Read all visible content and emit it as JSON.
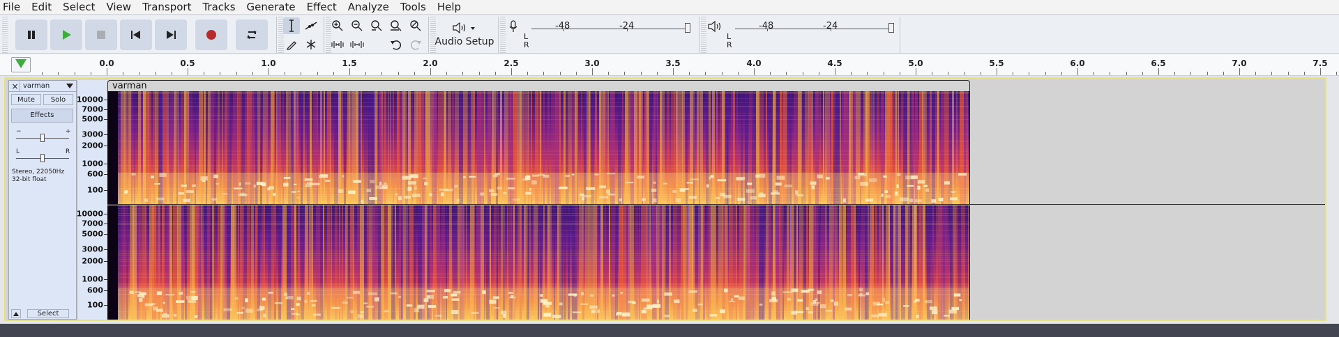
{
  "menu": [
    "File",
    "Edit",
    "Select",
    "View",
    "Transport",
    "Tracks",
    "Generate",
    "Effect",
    "Analyze",
    "Tools",
    "Help"
  ],
  "toolbar": {
    "audio_setup_label": "Audio Setup",
    "meter_labels": [
      "-48",
      "-24"
    ],
    "lr": [
      "L",
      "R"
    ]
  },
  "ruler": {
    "labels": [
      "0.0",
      "0.5",
      "1.0",
      "1.5",
      "2.0",
      "2.5",
      "3.0",
      "3.5",
      "4.0",
      "4.5",
      "5.0",
      "5.5",
      "6.0",
      "6.5",
      "7.0",
      "7.5"
    ]
  },
  "track": {
    "name": "varman",
    "mute_label": "Mute",
    "solo_label": "Solo",
    "effects_label": "Effects",
    "gain_minus": "−",
    "gain_plus": "+",
    "pan_left": "L",
    "pan_right": "R",
    "info_line1": "Stereo, 22050Hz",
    "info_line2": "32-bit float",
    "select_label": "Select",
    "clip_name": "varman",
    "freq_labels": [
      "10000",
      "7000",
      "5000",
      "3000",
      "2000",
      "1000",
      "600",
      "100"
    ],
    "gain_level": 0.5,
    "pan_level": 0.5
  },
  "colors": {
    "accent_play": "#3dad3d",
    "record": "#b52a2a",
    "track_border": "#e7e384",
    "spectrogram_low": "#1a0a3a",
    "spectrogram_high": "#ffe9a0"
  }
}
